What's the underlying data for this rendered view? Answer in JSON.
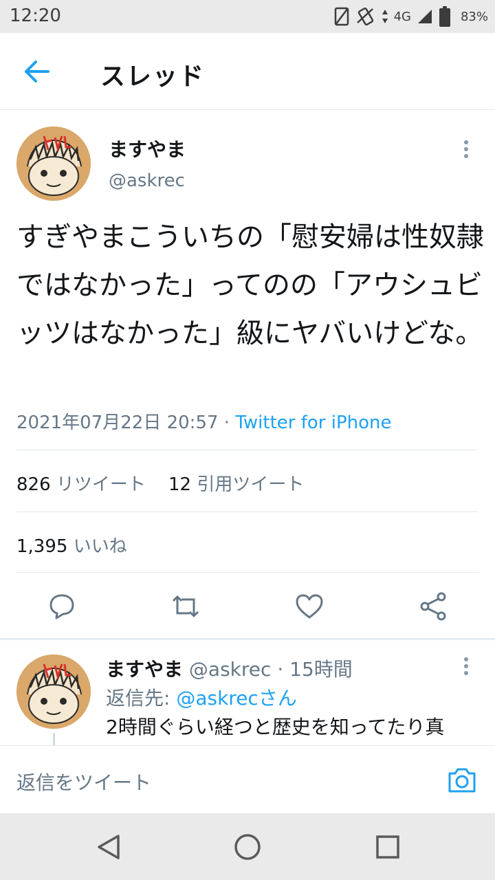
{
  "status_bar": {
    "time": "12:20",
    "network": "4G",
    "battery": "83%"
  },
  "header": {
    "title": "スレッド"
  },
  "tweet": {
    "author_name": "ますやま",
    "author_handle": "@askrec",
    "text": "すぎやまこういちの「慰安婦は性奴隷ではなかった」ってのの「アウシュビッツはなかった」級にヤバいけどな。",
    "timestamp": "2021年07月22日 20:57",
    "meta_separator": " · ",
    "source": "Twitter for iPhone",
    "retweets_count": "826",
    "retweets_label": "リツイート",
    "quotes_count": "12",
    "quotes_label": "引用ツイート",
    "likes_count": "1,395",
    "likes_label": "いいね"
  },
  "actions": {
    "reply_icon": "reply-icon",
    "retweet_icon": "retweet-icon",
    "like_icon": "heart-icon",
    "share_icon": "share-icon"
  },
  "reply": {
    "author_name": "ますやま",
    "author_handle": "@askrec",
    "time": "15時間",
    "reply_to_prefix": "返信先: ",
    "reply_to_handle": "@askrec",
    "reply_to_suffix": "さん",
    "text": "2時間ぐらい経つと歴史を知ってたり真"
  },
  "compose": {
    "placeholder": "返信をツイート"
  },
  "colors": {
    "accent": "#1da1f2",
    "muted": "#657786",
    "text": "#14171a"
  }
}
